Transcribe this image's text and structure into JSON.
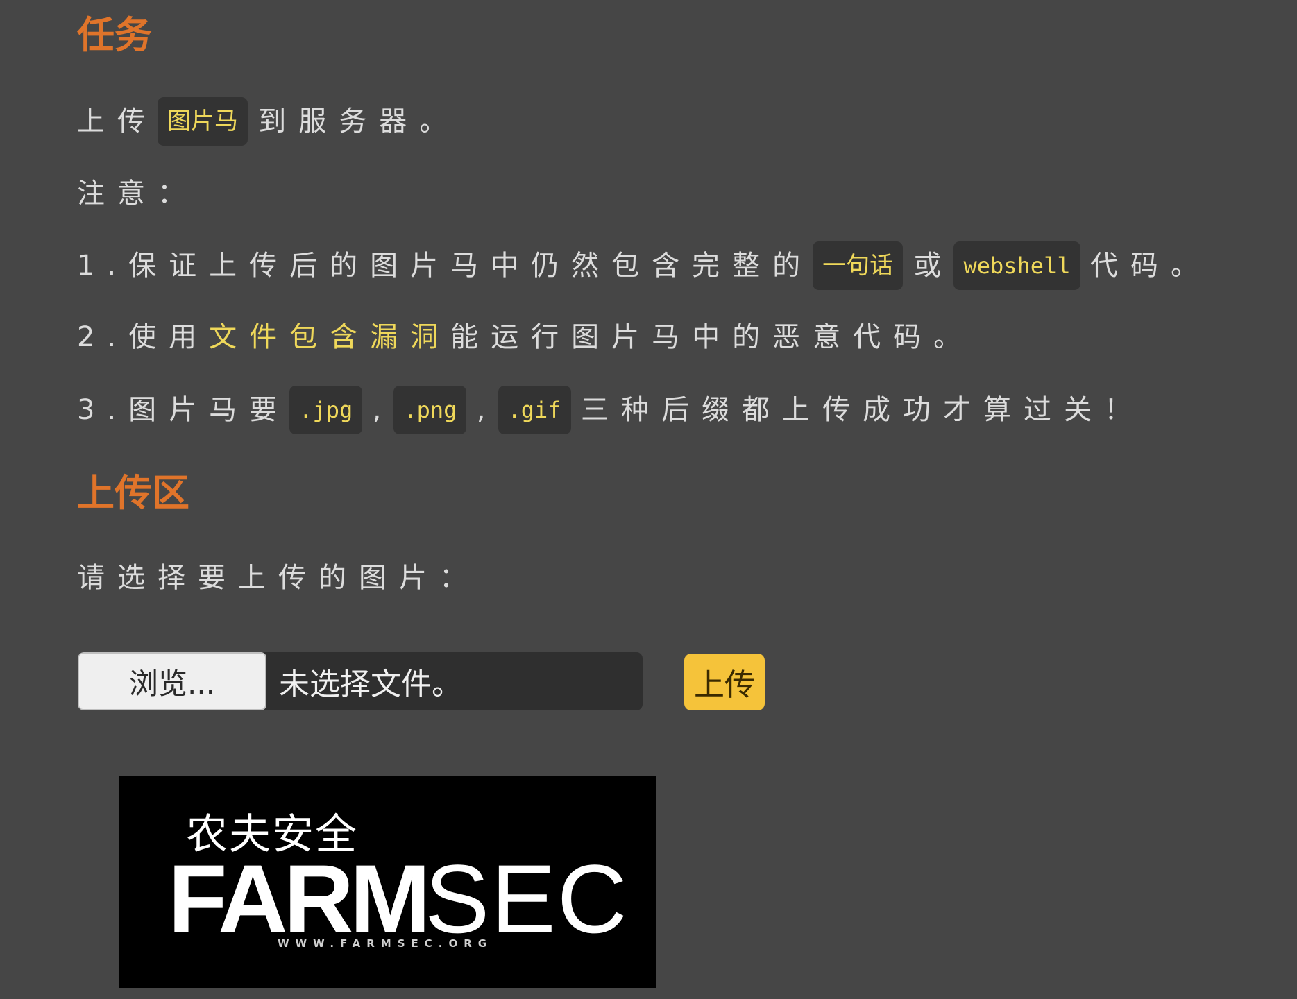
{
  "task": {
    "heading": "任务",
    "intro_before": "上传",
    "intro_code": "图片马",
    "intro_after": "到服务器。",
    "note": "注意：",
    "rule1_before": "1.保证上传后的图片马中仍然包含完整的",
    "rule1_code1": "一句话",
    "rule1_mid": "或",
    "rule1_code2": "webshell",
    "rule1_after": "代码。",
    "rule2_before": "2.使用",
    "rule2_highlight": "文件包含漏洞",
    "rule2_after": "能运行图片马中的恶意代码。",
    "rule3_before": "3.图片马要",
    "rule3_ext1": ".jpg",
    "rule3_sep1": ",",
    "rule3_ext2": ".png",
    "rule3_sep2": ",",
    "rule3_ext3": ".gif",
    "rule3_after": "三种后缀都上传成功才算过关！"
  },
  "upload": {
    "heading": "上传区",
    "prompt": "请选择要上传的图片：",
    "browse_label": "浏览...",
    "file_status": "未选择文件。",
    "submit_label": "上传"
  },
  "logo": {
    "cn_text": "农夫安全",
    "farm_text": "FARM",
    "sec_text": "SEC",
    "url_text": "WWW.FARMSEC.ORG"
  },
  "colors": {
    "background": "#464646",
    "heading": "#e0742a",
    "code_text": "#efd85a",
    "code_bg": "#333333",
    "submit_bg": "#f5c33a"
  }
}
